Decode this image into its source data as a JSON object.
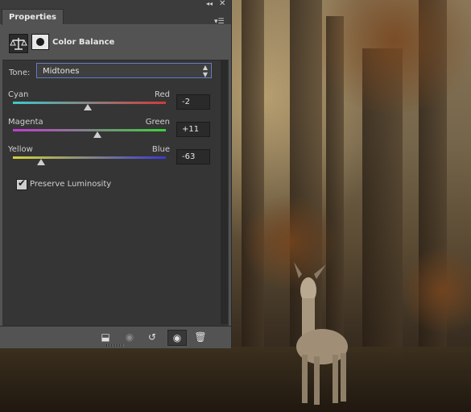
{
  "panel": {
    "tab_label": "Properties",
    "collapse_icon": "double-chevron-icon",
    "close_icon": "close-icon",
    "menu_icon": "panel-menu-icon",
    "header": {
      "title": "Color Balance",
      "adjustment_icon": "balance-scale-icon",
      "mask_icon": "layer-mask-icon"
    }
  },
  "tone": {
    "label": "Tone:",
    "selected": "Midtones"
  },
  "sliders": [
    {
      "left": "Cyan",
      "right": "Red",
      "value": "-2",
      "position": 0.49
    },
    {
      "left": "Magenta",
      "right": "Green",
      "value": "+11",
      "position": 0.555
    },
    {
      "left": "Yellow",
      "right": "Blue",
      "value": "-63",
      "position": 0.185
    }
  ],
  "preserve": {
    "label": "Preserve Luminosity",
    "checked": true
  },
  "footer": {
    "buttons": [
      {
        "name": "clip-to-layer-icon",
        "glyph": "⬓"
      },
      {
        "name": "view-previous-state-icon",
        "glyph": "◉"
      },
      {
        "name": "reset-icon",
        "glyph": "↺"
      },
      {
        "name": "toggle-visibility-icon",
        "glyph": "👁"
      },
      {
        "name": "delete-icon",
        "glyph": "🗑"
      }
    ]
  },
  "colors": {
    "track_cyan_red": [
      "#3ec9c9",
      "#d23a3a"
    ],
    "track_magenta_green": [
      "#c33ad2",
      "#3ad23a"
    ],
    "track_yellow_blue": [
      "#d2d23a",
      "#3a3ad2"
    ]
  }
}
